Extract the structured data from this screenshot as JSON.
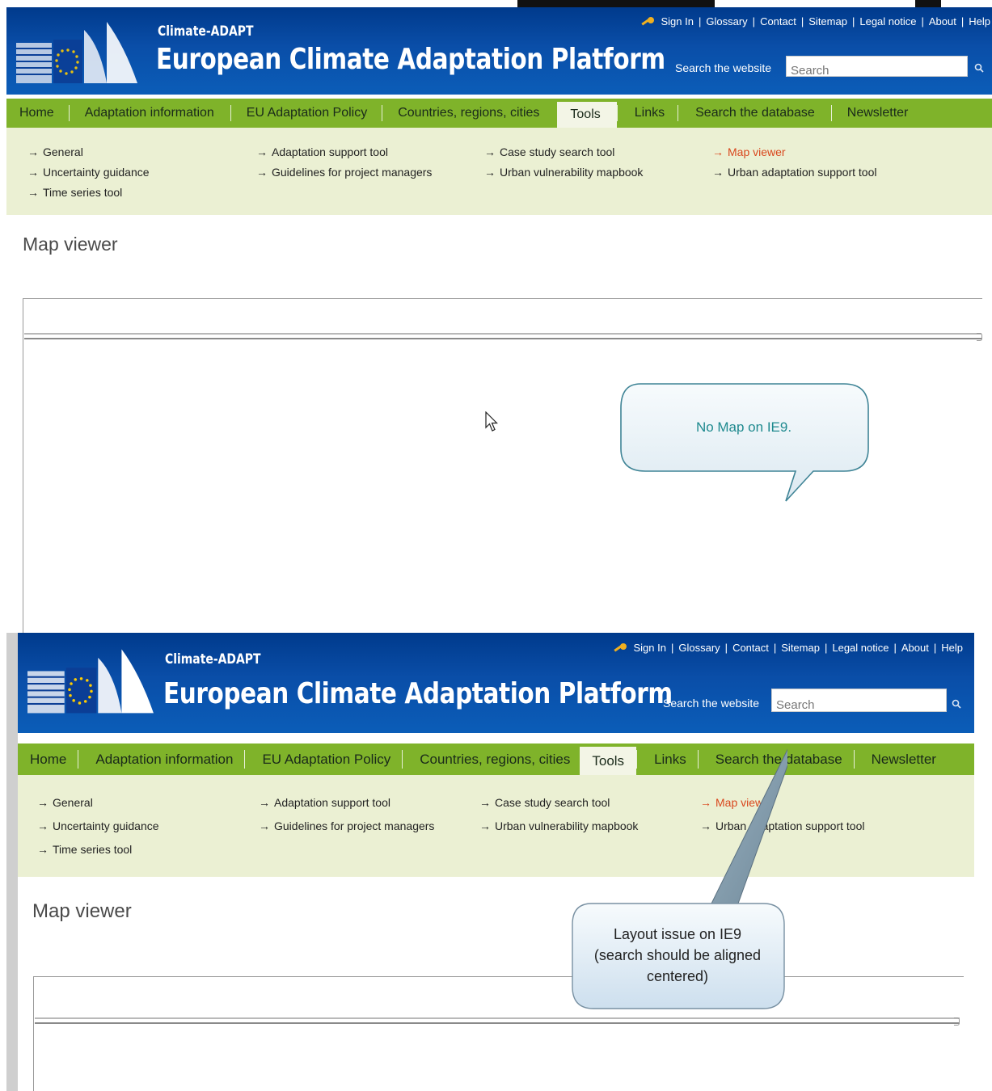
{
  "site": {
    "brand_small": "Climate-ADAPT",
    "brand_big": "European Climate Adaptation Platform",
    "top_links": [
      "Sign In",
      "Glossary",
      "Contact",
      "Sitemap",
      "Legal notice",
      "About",
      "Help"
    ],
    "search_label": "Search the website",
    "search_placeholder": "Search",
    "search_value": "Search"
  },
  "nav": [
    "Home",
    "Adaptation information",
    "EU Adaptation Policy",
    "Countries, regions, cities",
    "Tools",
    "Links",
    "Search the database",
    "Newsletter"
  ],
  "nav_active": "Tools",
  "subnav": {
    "col1": [
      "General",
      "Uncertainty guidance",
      "Time series tool"
    ],
    "col2": [
      "Adaptation support tool",
      "Guidelines for project managers"
    ],
    "col3": [
      "Case study search tool",
      "Urban vulnerability mapbook"
    ],
    "col4": [
      "Map viewer",
      "Urban adaptation support tool"
    ],
    "active": "Map viewer"
  },
  "page_title": "Map viewer",
  "callouts": {
    "no_map": "No Map on IE9.",
    "layout_issue_line1": "Layout issue on IE9",
    "layout_issue_line2": "(search should be aligned",
    "layout_issue_line3": "centered)"
  },
  "colors": {
    "header_blue": "#0b4ea8",
    "nav_green": "#7fb32a",
    "subnav_bg": "#ebf0d3",
    "active_link": "#d9471d",
    "callout_text": "#1f8a8f"
  },
  "icons": [
    "key-icon",
    "search-go-icon",
    "eu-logo",
    "arrow-icon",
    "mouse-cursor-icon"
  ]
}
